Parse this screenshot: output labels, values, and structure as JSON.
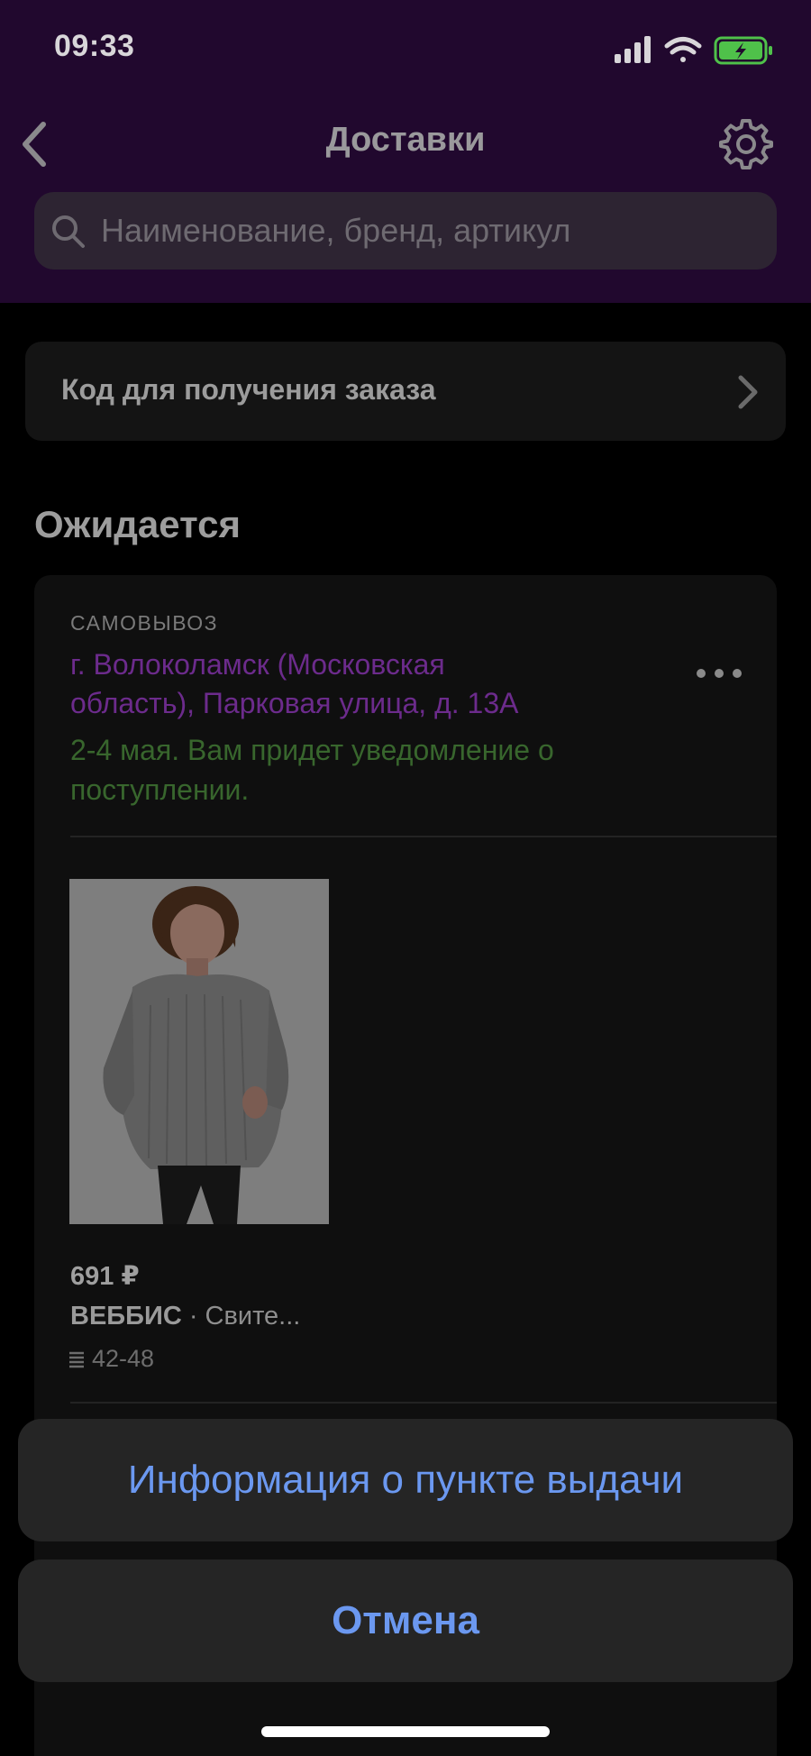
{
  "status_bar": {
    "time": "09:33",
    "icons": [
      "cellular-signal-icon",
      "wifi-icon",
      "battery-charging-icon"
    ]
  },
  "nav": {
    "title": "Доставки",
    "back_icon": "chevron-left-icon",
    "settings_icon": "gear-icon"
  },
  "search": {
    "placeholder": "Наименование, бренд, артикул",
    "icon": "search-icon"
  },
  "pickup_code": {
    "label": "Код для получения заказа"
  },
  "section": {
    "title": "Ожидается"
  },
  "delivery": {
    "type": "САМОВЫВОЗ",
    "address": "г. Волоколамск (Московская область), Парковая улица, д. 13А",
    "status": "2-4 мая. Вам придет уведомление о поступлении.",
    "item": {
      "price": "691 ₽",
      "brand": "ВЕББИС",
      "separator": " · ",
      "name": "Свите...",
      "size": "42-48"
    }
  },
  "action_sheet": {
    "info_label": "Информация о пункте выдачи",
    "cancel_label": "Отмена"
  },
  "colors": {
    "header_bg": "#21082e",
    "accent_purple": "#6c2b8c",
    "status_green": "#38662d",
    "action_blue": "#6b98f0"
  }
}
